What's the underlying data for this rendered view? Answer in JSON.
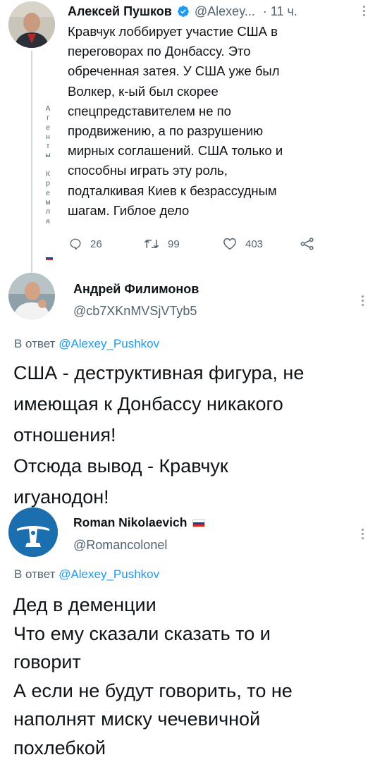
{
  "tweet1": {
    "author_name": "Алексей Пушков",
    "handle": "@Alexey...",
    "time": "· 11 ч.",
    "verified_icon": "verified-badge-icon",
    "text": "Кравчук лоббирует участие США в\nпереговорах по Донбассу.  Это\nобреченная затея. У США уже был\nВолкер, к-ый был скорее\nспецпредставителем не по\nпродвижению, а по разрушению\nмирных соглашений. США только и\nспособны играть эту роль,\nподталкивая Киев к безрассудным\nшагам. Гиблое дело",
    "side_label": "А\nг\nе\nн\nт\nы\n\nК\nр\nе\nм\nл\nя",
    "replies": "26",
    "retweets": "99",
    "likes": "403"
  },
  "tweet2": {
    "author_name": "Андрей Филимонов",
    "handle": "@cb7XKnMVSjVTyb5",
    "reply_prefix": "В ответ",
    "reply_to": "@Alexey_Pushkov",
    "text": "США - деструктивная фигура, не\nимеющая к Донбассу никакого\nотношения!\nОтсюда вывод - Кравчук\nигуанодон!"
  },
  "tweet3": {
    "author_name": "Roman Nikolaevich",
    "handle": "@Romancolonel",
    "reply_prefix": "В ответ",
    "reply_to": "@Alexey_Pushkov",
    "text": "Дед в деменции\nЧто ему сказали сказать то и\nговорит\nА если не будут говорить, то не\nнаполнят миску чечевичной\nпохлебкой"
  },
  "colors": {
    "link": "#1d9bf0",
    "muted": "#536471",
    "verified": "#1d9bf0",
    "avatar3_bg": "#1b6fae"
  },
  "icons": [
    "reply-icon",
    "retweet-icon",
    "like-icon",
    "share-icon",
    "more-options-icon",
    "russia-flag-icon"
  ]
}
